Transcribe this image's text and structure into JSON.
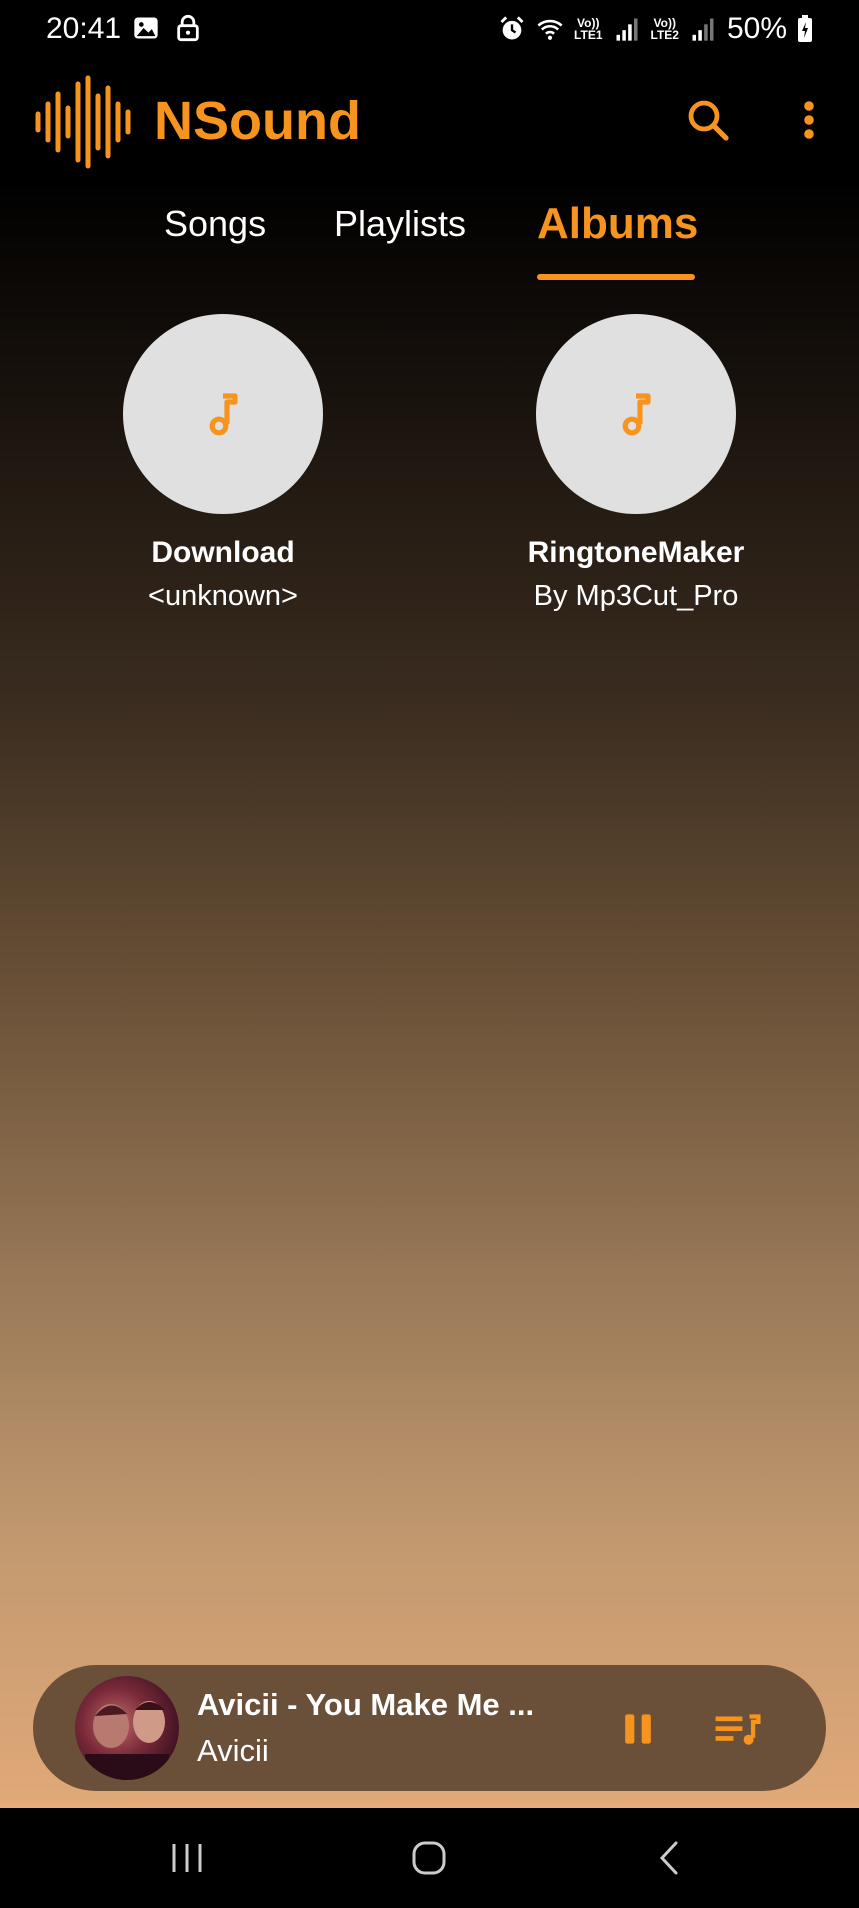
{
  "status_bar": {
    "time": "20:41",
    "sim1_label_top": "Vo))",
    "sim1_label_bottom": "LTE1",
    "sim2_label_top": "Vo))",
    "sim2_label_bottom": "LTE2",
    "battery": "50%"
  },
  "app": {
    "title": "NSound",
    "accent_color": "#f7941d"
  },
  "tabs": [
    {
      "label": "Songs",
      "selected": false
    },
    {
      "label": "Playlists",
      "selected": false
    },
    {
      "label": "Albums",
      "selected": true
    }
  ],
  "albums": [
    {
      "title": "Download",
      "artist": "<unknown>"
    },
    {
      "title": "RingtoneMaker",
      "artist": "By Mp3Cut_Pro"
    }
  ],
  "now_playing": {
    "title": "Avicii - You Make Me ...",
    "artist": "Avicii"
  }
}
